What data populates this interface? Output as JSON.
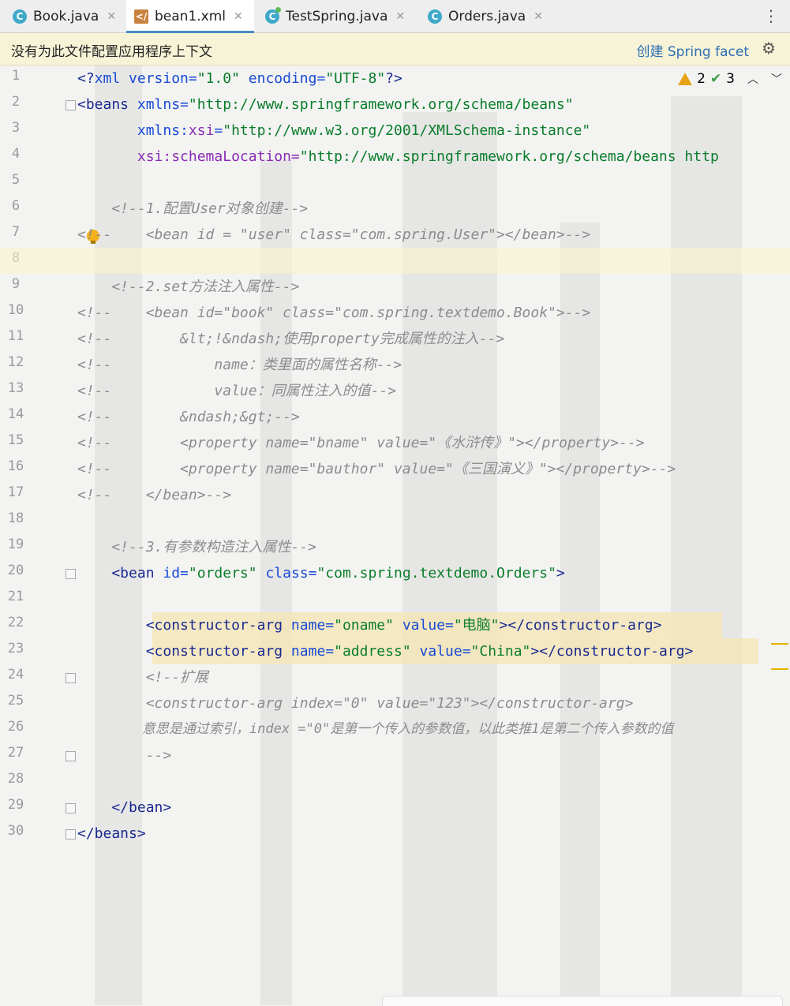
{
  "tabs": [
    {
      "label": "Book.java",
      "type": "class"
    },
    {
      "label": "bean1.xml",
      "type": "xml",
      "active": true
    },
    {
      "label": "TestSpring.java",
      "type": "test"
    },
    {
      "label": "Orders.java",
      "type": "class"
    }
  ],
  "banner": {
    "message": "没有为此文件配置应用程序上下文",
    "action": "创建 Spring facet"
  },
  "inspection": {
    "warnings": "2",
    "checks": "3"
  },
  "line_numbers": [
    "1",
    "2",
    "3",
    "4",
    "5",
    "6",
    "7",
    "8",
    "9",
    "10",
    "11",
    "12",
    "13",
    "14",
    "15",
    "16",
    "17",
    "18",
    "19",
    "20",
    "21",
    "22",
    "23",
    "24",
    "25",
    "26",
    "27",
    "28",
    "29",
    "30"
  ],
  "code": {
    "l1": {
      "a": "<?",
      "b": "xml",
      "c": " version=",
      "d": "\"1.0\"",
      "e": " encoding=",
      "f": "\"UTF-8\"",
      "g": "?>"
    },
    "l2": {
      "a": "<beans",
      "b": " xmlns=",
      "c": "\"http://www.springframework.org/schema/beans\""
    },
    "l3": {
      "a": "       xmlns:",
      "b": "xsi",
      "c": "=",
      "d": "\"http://www.w3.org/2001/XMLSchema-instance\""
    },
    "l4": {
      "a": "       xsi:schemaLocation=",
      "b": "\"http://www.springframework.org/schema/beans http"
    },
    "l6": "    <!--1.配置User对象创建-->",
    "l7": "<!--    <bean id = \"user\" class=\"com.spring.User\"></bean>-->",
    "l9": "    <!--2.set方法注入属性-->",
    "l10": "<!--    <bean id=\"book\" class=\"com.spring.textdemo.Book\">-->",
    "l11": "<!--        &lt;!&ndash;使用property完成属性的注入-->",
    "l12": "<!--            name：类里面的属性名称-->",
    "l13": "<!--            value：同属性注入的值-->",
    "l14": "<!--        &ndash;&gt;-->",
    "l15": "<!--        <property name=\"bname\" value=\"《水浒传》\"></property>-->",
    "l16": "<!--        <property name=\"bauthor\" value=\"《三国演义》\"></property>-->",
    "l17": "<!--    </bean>-->",
    "l19": "    <!--3.有参数构造注入属性-->",
    "l20": {
      "a": "    <bean",
      "b": " id=",
      "c": "\"orders\"",
      "d": " class=",
      "e": "\"com.spring.textdemo.Orders\"",
      "f": ">"
    },
    "l22": {
      "a": "        <constructor-arg",
      "b": " name=",
      "c": "\"oname\"",
      "d": " value=",
      "e": "\"电脑\"",
      "f": "></constructor-arg>"
    },
    "l23": {
      "a": "        <constructor-arg",
      "b": " name=",
      "c": "\"address\"",
      "d": " value=",
      "e": "\"China\"",
      "f": "></constructor-arg>"
    },
    "l24": "        <!--扩展",
    "l25": "        <constructor-arg index=\"0\" value=\"123\"></constructor-arg>",
    "l26": "        意思是通过索引，index =\"0\"是第一个传入的参数值，以此类推1是第二个传入参数的值",
    "l27": "        -->",
    "l29": "    </bean>",
    "l30": "</beans>"
  }
}
